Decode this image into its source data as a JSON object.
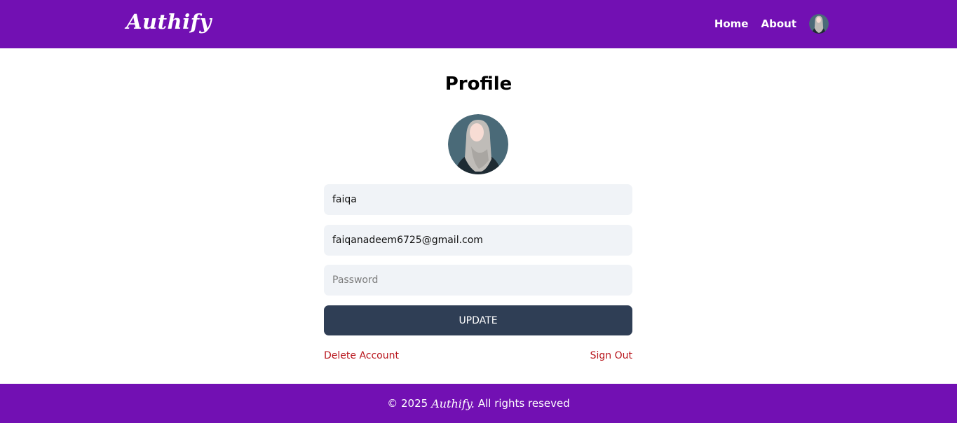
{
  "header": {
    "logo": "Authify",
    "nav": [
      {
        "label": "Home"
      },
      {
        "label": "About"
      }
    ],
    "avatar_icon": "user-avatar-hijab"
  },
  "profile": {
    "title": "Profile",
    "avatar_icon": "user-avatar-hijab",
    "username_value": "faiqa",
    "email_value": "faiqanadeem6725@gmail.com",
    "password_placeholder": "Password",
    "update_label": "UPDATE",
    "delete_label": "Delete Account",
    "signout_label": "Sign Out"
  },
  "footer": {
    "copyright_prefix": "© 2025",
    "brand": "Authify.",
    "rights": "All rights reseved"
  },
  "colors": {
    "brand_purple": "#7210b3",
    "button_dark": "#2f3e55",
    "danger_red": "#b8141b",
    "input_bg": "#f0f3f7"
  }
}
